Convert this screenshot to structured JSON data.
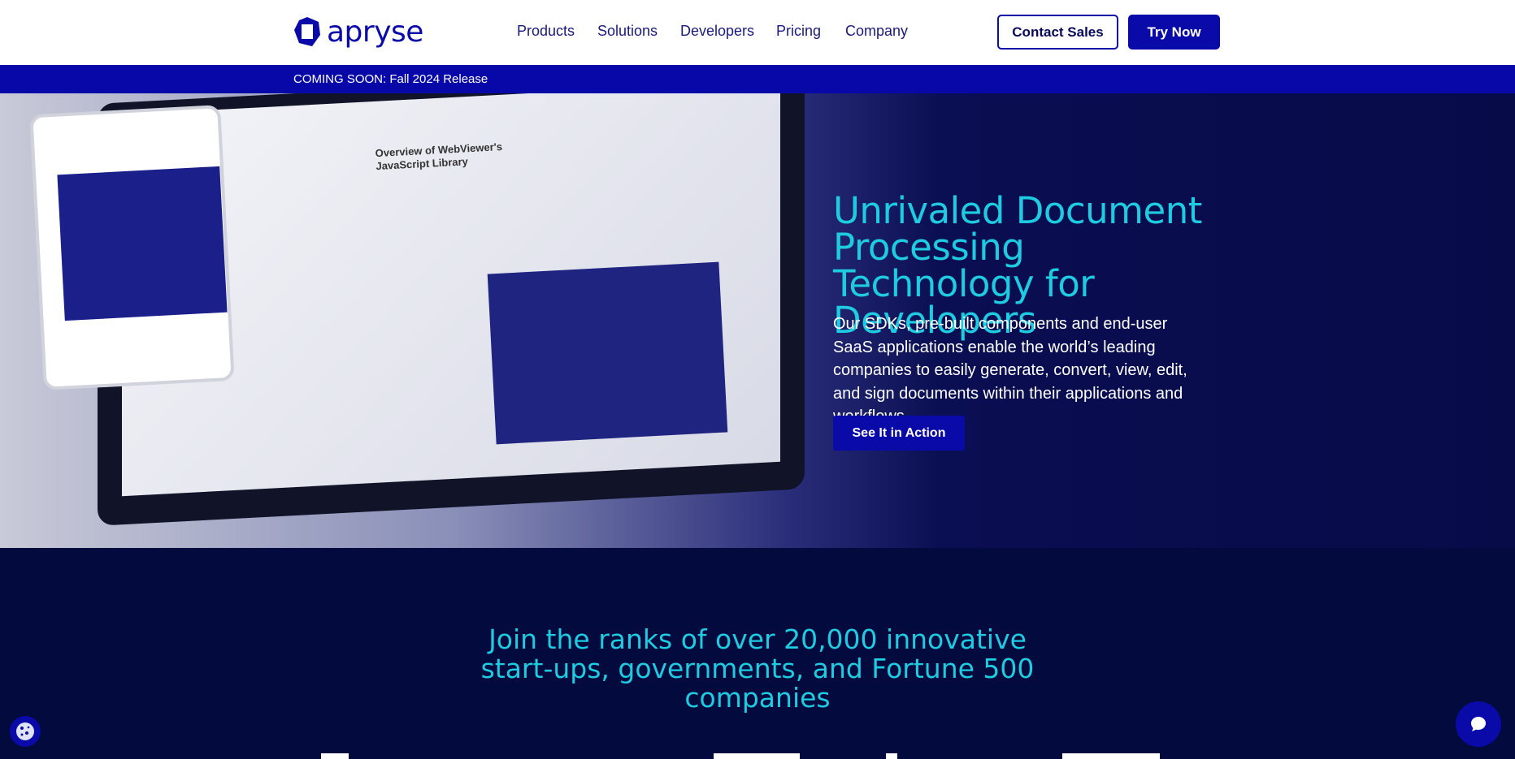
{
  "header": {
    "logo": "apryse",
    "nav": [
      "Products",
      "Solutions",
      "Developers",
      "Pricing",
      "Company"
    ],
    "contact_sales": "Contact Sales",
    "try_now": "Try Now"
  },
  "banner": {
    "text": "COMING SOON: Fall 2024 Release"
  },
  "hero": {
    "title": "Unrivaled Document Processing Technology for Developers",
    "description": "Our SDKs, pre-built components and end-user SaaS applications enable the world’s leading companies to easily generate, convert, view, edit, and sign documents within their applications and workflows.",
    "cta": "See It in Action",
    "image_doc_title": "Overview of WebViewer's JavaScript Library"
  },
  "clients": {
    "heading": "Join the ranks of over 20,000 innovative start-ups, governments, and Fortune 500 companies"
  },
  "colors": {
    "brand": "#0a0aa8",
    "accent": "#1ecbe1",
    "dark_bg": "#020a3e"
  },
  "icons": {
    "cookie": "cookie-icon",
    "chat": "chat-bubble-icon"
  }
}
